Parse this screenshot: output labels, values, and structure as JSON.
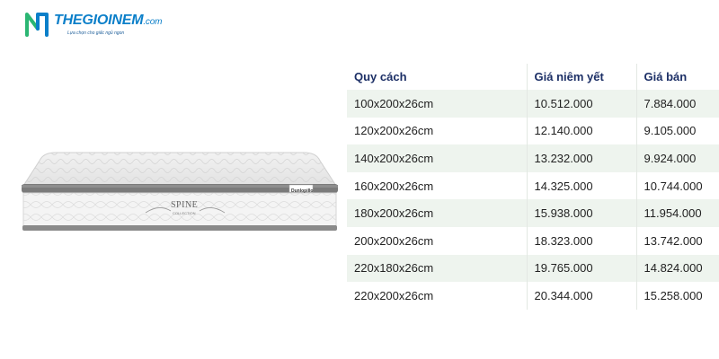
{
  "logo": {
    "wordmark": "THEGIOINEM",
    "domain_suffix": ".com",
    "tagline": "Lựa chọn cho giấc ngủ ngon"
  },
  "product_image": {
    "model_text": "SPINE",
    "model_subtext": "COLLECTION",
    "brand_label": "Dunlopillo"
  },
  "price_table": {
    "headers": [
      "Quy cách",
      "Giá niêm yết",
      "Giá bán"
    ],
    "rows": [
      [
        "100x200x26cm",
        "10.512.000",
        "7.884.000"
      ],
      [
        "120x200x26cm",
        "12.140.000",
        "9.105.000"
      ],
      [
        "140x200x26cm",
        "13.232.000",
        "9.924.000"
      ],
      [
        "160x200x26cm",
        "14.325.000",
        "10.744.000"
      ],
      [
        "180x200x26cm",
        "15.938.000",
        "11.954.000"
      ],
      [
        "200x200x26cm",
        "18.323.000",
        "13.742.000"
      ],
      [
        "220x180x26cm",
        "19.765.000",
        "14.824.000"
      ],
      [
        "220x200x26cm",
        "20.344.000",
        "15.258.000"
      ]
    ]
  },
  "colors": {
    "logo_blue": "#0b7fc9",
    "logo_green": "#2bb673",
    "header_text": "#1c2f66",
    "row_stripe": "#eef4ee"
  }
}
